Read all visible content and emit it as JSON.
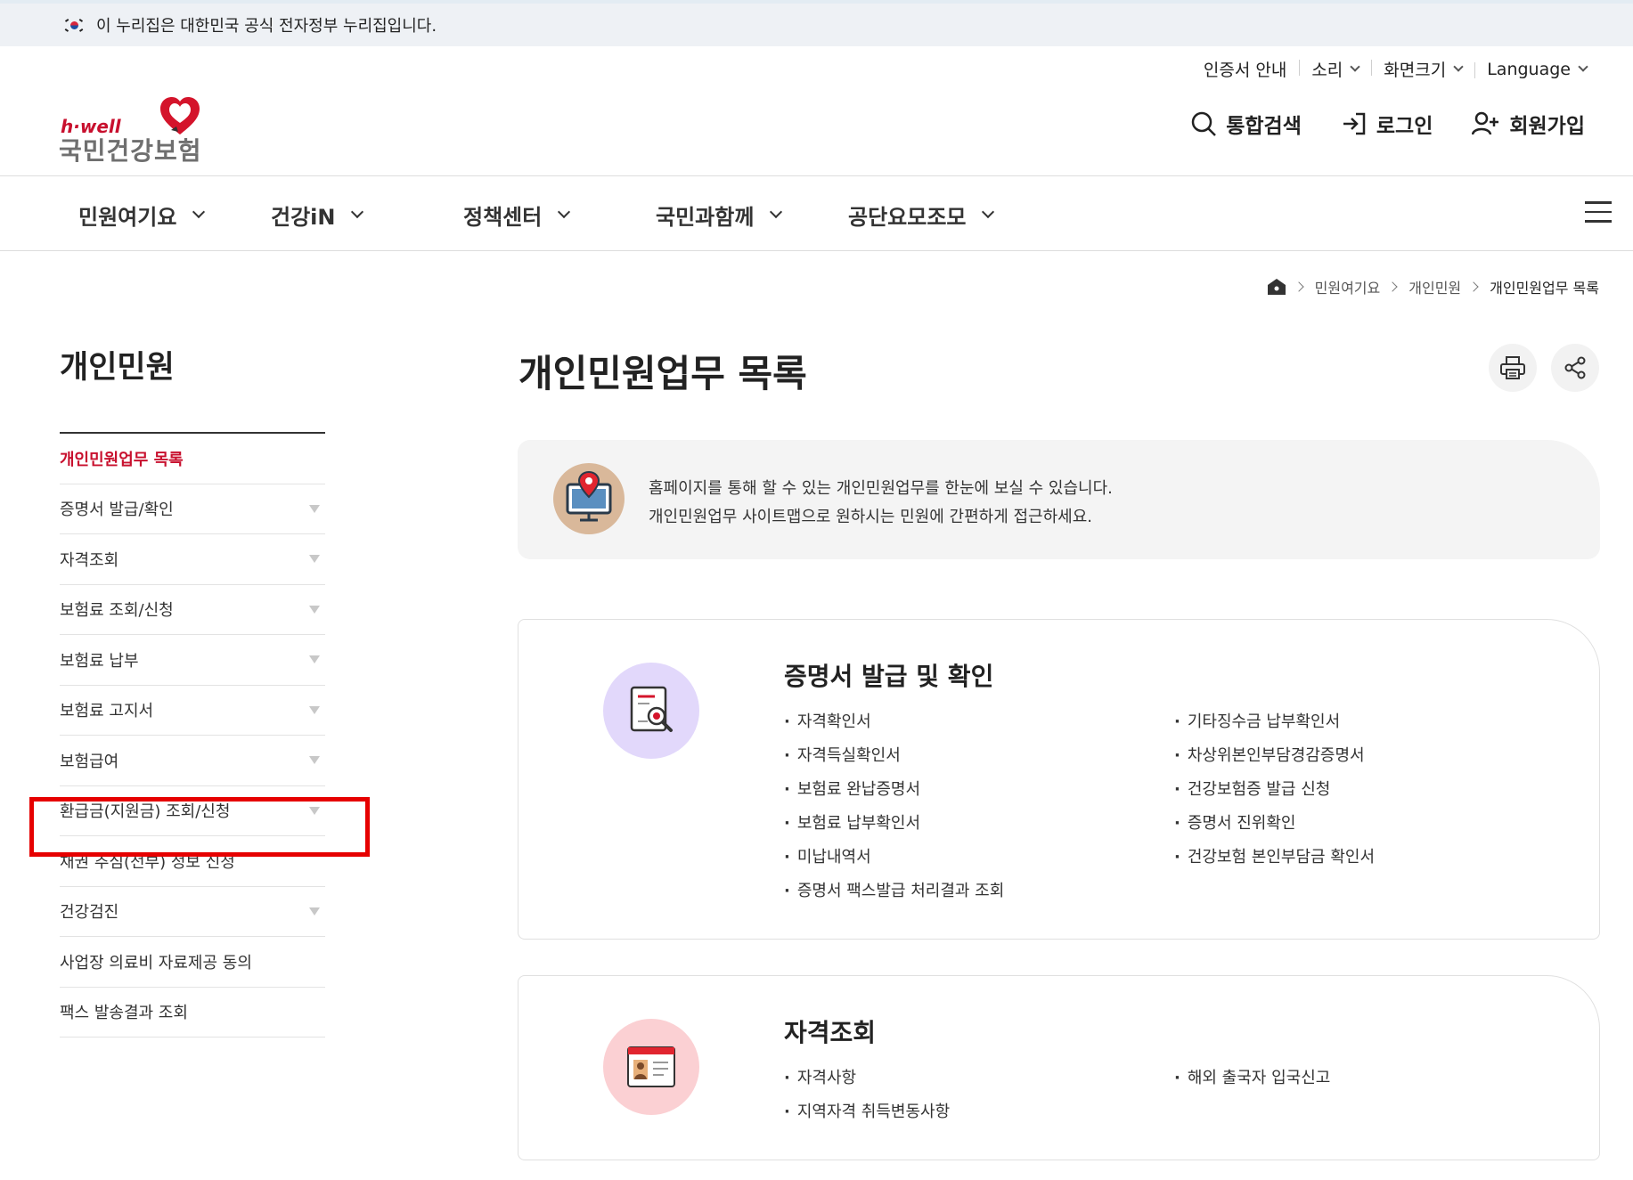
{
  "gov_banner": {
    "text": "이 누리집은 대한민국 공식 전자정부 누리집입니다."
  },
  "utility": {
    "cert": "인증서 안내",
    "sound": "소리",
    "screen_size": "화면크기",
    "language": "Language"
  },
  "logo": {
    "tag": "h·well",
    "name": "국민건강보험"
  },
  "header": {
    "search": "통합검색",
    "login": "로그인",
    "signup": "회원가입"
  },
  "gnb": {
    "items": [
      "민원여기요",
      "건강iN",
      "정책센터",
      "국민과함께",
      "공단요모조모"
    ]
  },
  "breadcrumb": {
    "level1": "민원여기요",
    "level2": "개인민원",
    "current": "개인민원업무 목록"
  },
  "sidebar": {
    "title": "개인민원",
    "items": [
      {
        "label": "개인민원업무 목록"
      },
      {
        "label": "증명서 발급/확인"
      },
      {
        "label": "자격조회"
      },
      {
        "label": "보험료 조회/신청"
      },
      {
        "label": "보험료 납부"
      },
      {
        "label": "보험료 고지서"
      },
      {
        "label": "보험급여"
      },
      {
        "label": "환급금(지원금) 조회/신청"
      },
      {
        "label": "채권 추심(전부) 정보 신청"
      },
      {
        "label": "건강검진"
      },
      {
        "label": "사업장 의료비 자료제공 동의"
      },
      {
        "label": "팩스 발송결과 조회"
      }
    ]
  },
  "main": {
    "title": "개인민원업무 목록",
    "notice_line1": "홈페이지를 통해 할 수 있는 개인민원업무를 한눈에 보실 수 있습니다.",
    "notice_line2": "개인민원업무 사이트맵으로 원하시는 민원에 간편하게 접근하세요.",
    "cards": [
      {
        "title": "증명서 발급 및 확인",
        "left": [
          "자격확인서",
          "자격득실확인서",
          "보험료 완납증명서",
          "보험료 납부확인서",
          "미납내역서",
          "증명서 팩스발급 처리결과 조회"
        ],
        "right": [
          "기타징수금 납부확인서",
          "차상위본인부담경감증명서",
          "건강보험증 발급 신청",
          "증명서 진위확인",
          "건강보험 본인부담금 확인서"
        ]
      },
      {
        "title": "자격조회",
        "left": [
          "자격사항",
          "지역자격 취득변동사항"
        ],
        "right": [
          "해외 출국자 입국신고"
        ]
      }
    ]
  },
  "colors": {
    "accent": "#c8102e",
    "highlight_box": "#e60000",
    "card1_icon_bg": "#e2d8fb",
    "card2_icon_bg": "#fbd0d3"
  }
}
